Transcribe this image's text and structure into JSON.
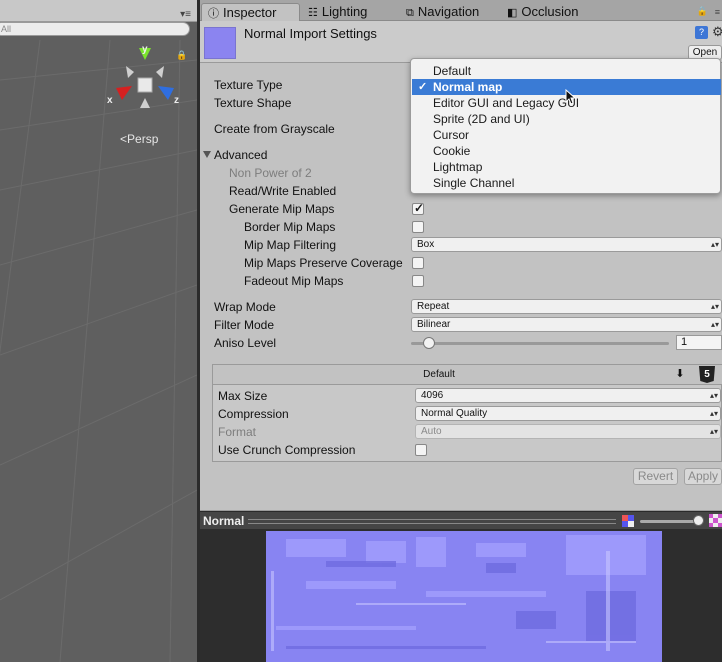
{
  "scene": {
    "search_placeholder": "All",
    "camera_label": "Persp",
    "gizmo_axes": {
      "x": "x",
      "y": "y",
      "z": "z"
    },
    "colors": {
      "background": "#5f5f5f",
      "x_axis": "#d52020",
      "y_axis": "#7be22d",
      "z_axis": "#2f6ee0"
    }
  },
  "tabs": [
    {
      "label": "Inspector",
      "icon": "info-icon",
      "active": true
    },
    {
      "label": "Lighting",
      "icon": "lighting-icon",
      "active": false
    },
    {
      "label": "Navigation",
      "icon": "navigation-icon",
      "active": false
    },
    {
      "label": "Occlusion",
      "icon": "occlusion-icon",
      "active": false
    }
  ],
  "header": {
    "title": "Normal Import Settings",
    "open_label": "Open",
    "help_icon": "?"
  },
  "fields": {
    "texture_type": "Texture Type",
    "texture_shape": "Texture Shape",
    "create_from_grayscale": "Create from Grayscale",
    "advanced": "Advanced",
    "non_power_of_2": "Non Power of 2",
    "read_write": "Read/Write Enabled",
    "generate_mips": "Generate Mip Maps",
    "border_mips": "Border Mip Maps",
    "mip_filtering": "Mip Map Filtering",
    "mip_filtering_value": "Box",
    "preserve_coverage": "Mip Maps Preserve Coverage",
    "fadeout_mips": "Fadeout Mip Maps",
    "wrap_mode": "Wrap Mode",
    "wrap_mode_value": "Repeat",
    "filter_mode": "Filter Mode",
    "filter_mode_value": "Bilinear",
    "aniso_level": "Aniso Level",
    "aniso_value": "1"
  },
  "checks": {
    "generate_mips": true,
    "border_mips": false,
    "preserve_coverage": false,
    "fadeout_mips": false
  },
  "platform": {
    "tab_default": "Default",
    "max_size": "Max Size",
    "max_size_value": "4096",
    "compression": "Compression",
    "compression_value": "Normal Quality",
    "format": "Format",
    "format_value": "Auto",
    "crunch": "Use Crunch Compression",
    "html5_glyph": "5"
  },
  "buttons": {
    "revert": "Revert",
    "apply": "Apply"
  },
  "dropdown": {
    "options": [
      "Default",
      "Normal map",
      "Editor GUI and Legacy GUI",
      "Sprite (2D and UI)",
      "Cursor",
      "Cookie",
      "Lightmap",
      "Single Channel"
    ],
    "selected": "Normal map",
    "check_glyph": "✓"
  },
  "preview": {
    "title": "Normal",
    "texture_color": "#8884f2"
  },
  "colors": {
    "accent": "#3a7bd5",
    "inspector_bg": "#c2c2c2"
  }
}
